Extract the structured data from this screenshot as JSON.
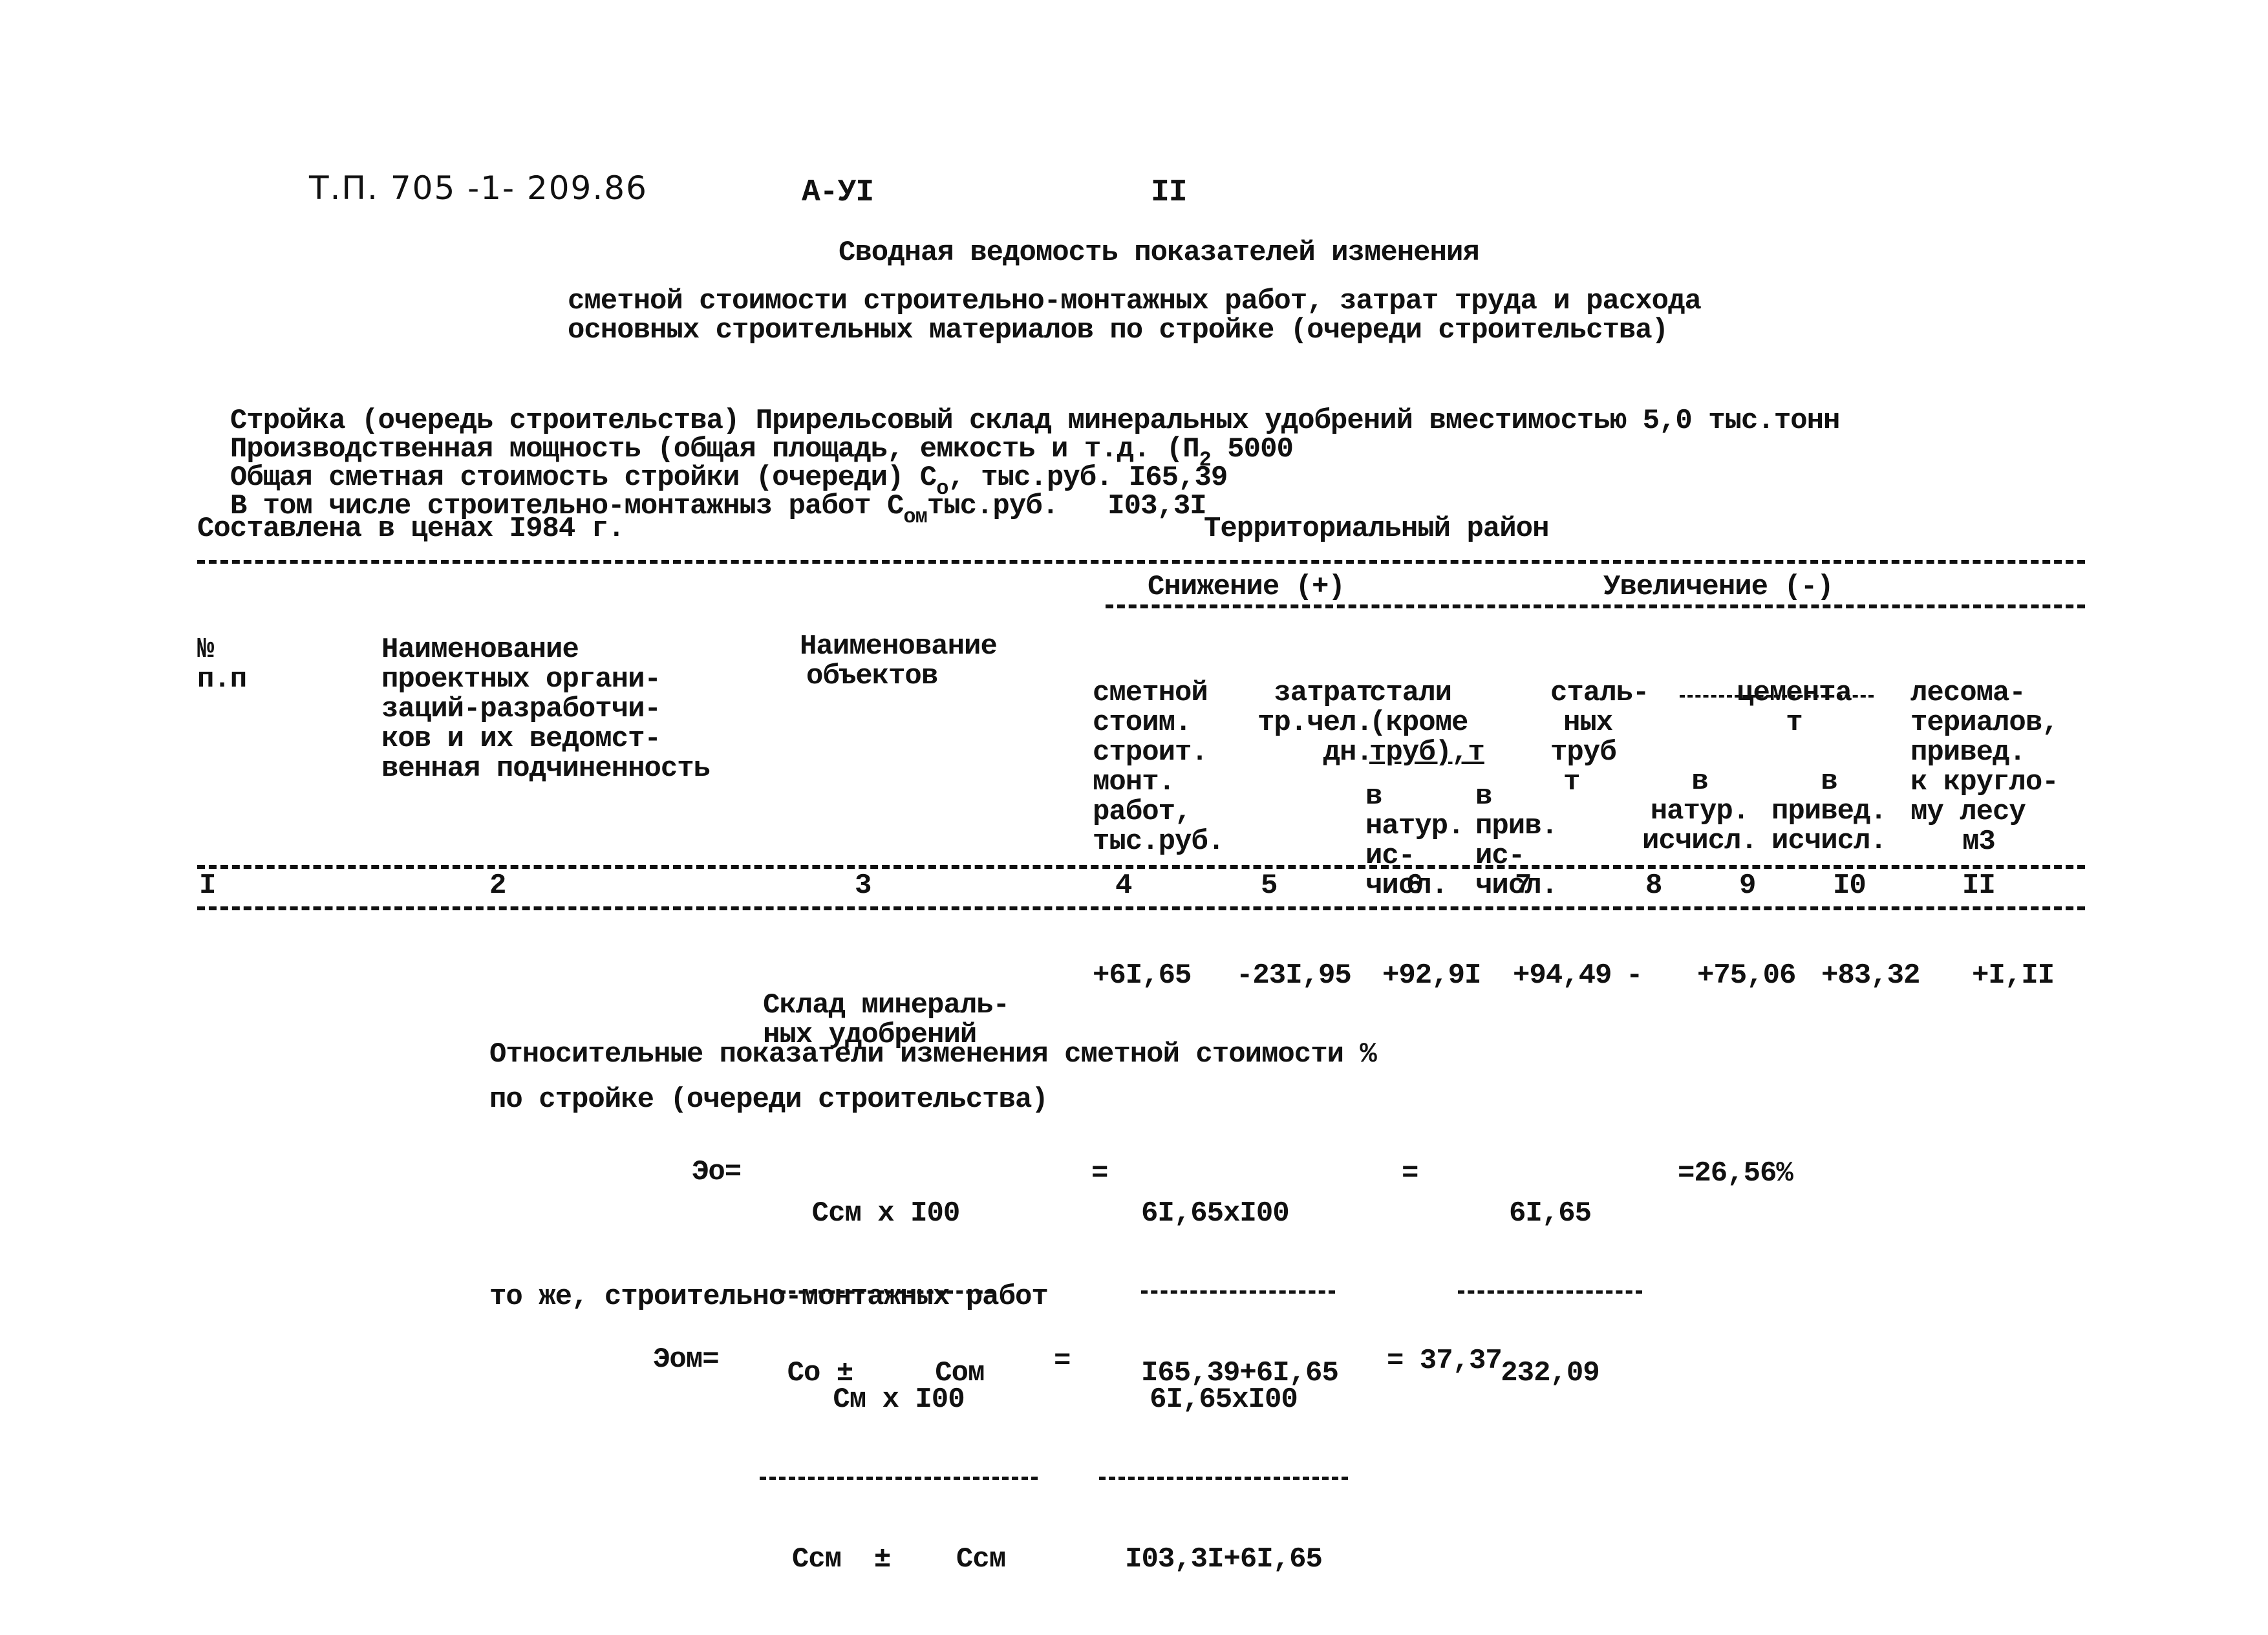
{
  "header": {
    "doc_code": "Т.П. 705 -1- 209.86",
    "album": "А-УI",
    "page": "II"
  },
  "title": {
    "line1": "Сводная ведомость показателей изменения",
    "line2": "сметной стоимости строительно-монтажных работ, затрат труда и расхода",
    "line3": "основных строительных материалов по стройке (очереди строительства)"
  },
  "info": {
    "project_label": "Стройка (очередь строительства)",
    "project_value": "Прирельсовый склад минеральных удобрений вместимостью 5,0 тыс.тонн",
    "capacity_label": "Производственная мощность (общая площадь, емкость и т.д.",
    "capacity_symbol": "(П",
    "capacity_sub": "2",
    "capacity_value": "5000",
    "total_label": "Общая сметная стоимость стройки (очереди)",
    "total_symbol": "С",
    "total_sub": "о",
    "total_unit": ", тыс.руб.",
    "total_value": "I65,39",
    "smr_label": "В том числе строительно-монтажныз работ",
    "smr_symbol": "С",
    "smr_sub": "ом",
    "smr_unit": "тыс.руб.",
    "smr_value": "I03,3I",
    "prices_label": "Составлена в ценах I984 г.",
    "region_label": "Территориальный район"
  },
  "table": {
    "headers": {
      "num": [
        "№",
        "п.п"
      ],
      "org": [
        "Наименование",
        "проектных органи-",
        "заций-разработчи-",
        "ков и их ведомст-",
        "венная подчиненность"
      ],
      "obj": [
        "Наименование",
        "объектов"
      ],
      "decrease": "Снижение (+)",
      "increase": "Увеличение (-)",
      "c4": [
        "сметной",
        "стоим.",
        "строит.",
        "монт.",
        "работ,",
        "тыс.руб."
      ],
      "c5": [
        "затрат",
        "тр.чел.",
        "дн."
      ],
      "c67_top": [
        "стали",
        "(кроме",
        "труб),т"
      ],
      "c6": [
        "в",
        "натур.",
        "ис-",
        "числ."
      ],
      "c7": [
        "в",
        "прив.",
        "ис-",
        "числ."
      ],
      "c8": [
        "сталь-",
        "ных",
        "труб",
        "т"
      ],
      "c910_top": [
        "цемента",
        "т"
      ],
      "c9": [
        "в",
        "натур.",
        "исчисл."
      ],
      "c10": [
        "в",
        "привед.",
        "исчисл."
      ],
      "c11": [
        "лесома-",
        "териалов,",
        "привед.",
        "к кругло-",
        "му лесу",
        "м3"
      ]
    },
    "column_numbers": [
      "I",
      "2",
      "3",
      "4",
      "5",
      "6",
      "7",
      "8",
      "9",
      "I0",
      "II"
    ],
    "rows": [
      {
        "object": [
          "Склад минераль-",
          "ных удобрений"
        ],
        "c4": "+6I,65",
        "c5": "-23I,95",
        "c6": "+92,9I",
        "c7": "+94,49",
        "c8": "-",
        "c9": "+75,06",
        "c10": "+83,32",
        "c11": "+I,II"
      }
    ]
  },
  "relative": {
    "line1": "Относительные показатели изменения сметной стоимости %",
    "line2": "по стройке (очереди строительства)",
    "formula1": {
      "lhs": "Эо=",
      "f1_num": "Ссм х I00",
      "f1_den": "Со ±     Сом",
      "eq1": "=",
      "f2_num": "6I,65хI00",
      "f2_den": "I65,39+6I,65",
      "eq2": "=",
      "f3_num": "6I,65",
      "f3_den": "232,09",
      "result": "=26,56%"
    },
    "line3": "то же, строительно-монтажных работ",
    "formula2": {
      "lhs": "Эом=",
      "f1_num": "См х I00",
      "f1_den": "Ссм  ±    Ссм",
      "eq1": "=",
      "f2_num": "6I,65хI00",
      "f2_den": "I03,3I+6I,65",
      "result": "= 37,37"
    }
  }
}
